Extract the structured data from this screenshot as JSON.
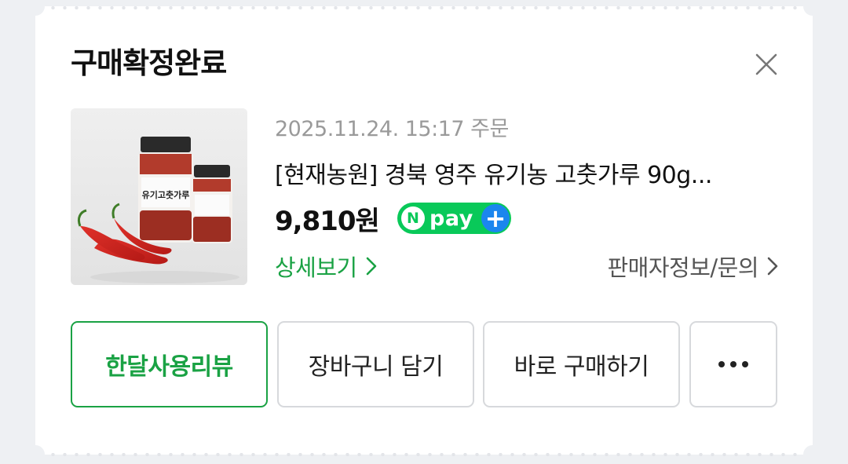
{
  "dialog": {
    "title": "구매확정완료"
  },
  "order": {
    "date": "2025.11.24. 15:17 주문",
    "product_name": "[현재농원] 경북 영주 유기농 고춧가루 90g...",
    "price": "9,810원",
    "npay": {
      "n": "N",
      "pay": "pay",
      "plus": "+"
    },
    "product_image_label": "유기고춧가루"
  },
  "links": {
    "detail": "상세보기",
    "seller": "판매자정보/문의"
  },
  "actions": {
    "review": "한달사용리뷰",
    "cart": "장바구니 담기",
    "buy": "바로 구매하기"
  },
  "colors": {
    "accent_green": "#1aa244",
    "npay_green": "#09c959",
    "npay_blue": "#1b86ee"
  },
  "icons": {
    "close": "close-icon",
    "chevron": "chevron-right-icon",
    "more": "more-horizontal-icon"
  }
}
